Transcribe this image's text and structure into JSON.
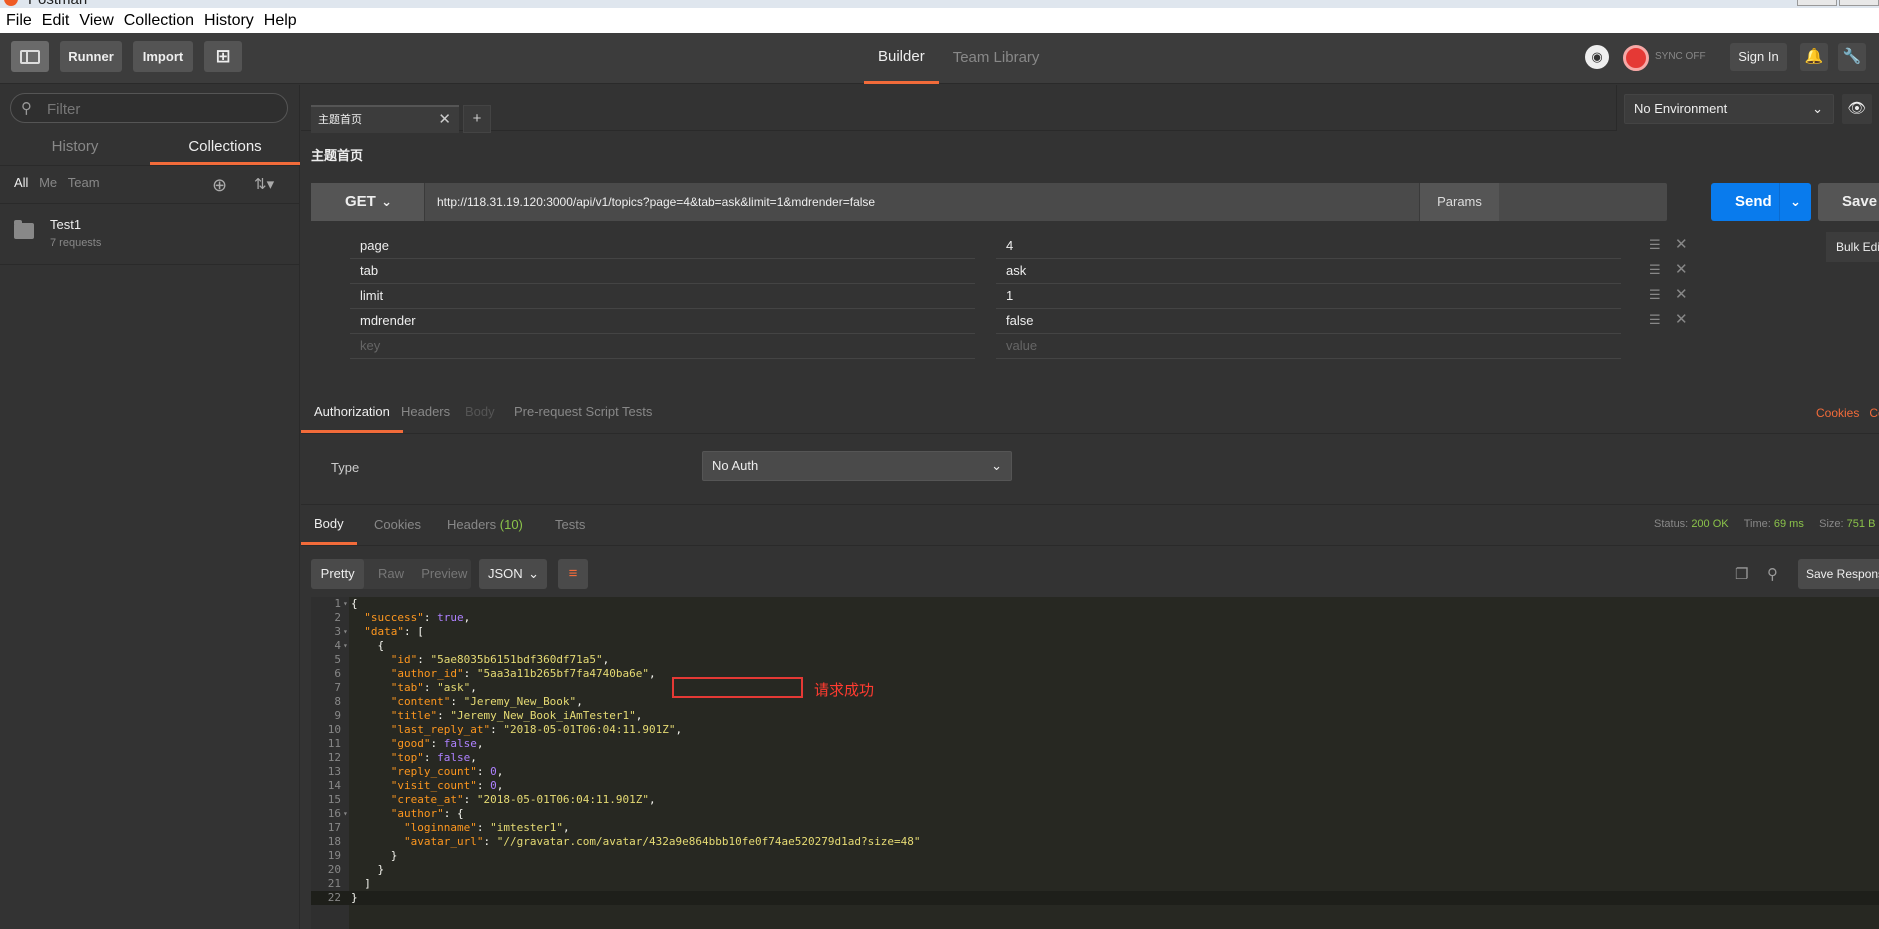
{
  "app": {
    "title": "Postman"
  },
  "menu": [
    "File",
    "Edit",
    "View",
    "Collection",
    "History",
    "Help"
  ],
  "toolbar": {
    "runner": "Runner",
    "import": "Import",
    "tabs": [
      "Builder",
      "Team Library"
    ],
    "sync_status": "SYNC OFF",
    "sign_in": "Sign In"
  },
  "sidebar": {
    "filter_placeholder": "Filter",
    "tabs": [
      "History",
      "Collections"
    ],
    "filters": [
      "All",
      "Me",
      "Team"
    ],
    "collections": [
      {
        "name": "Test1",
        "count": "7 requests"
      }
    ]
  },
  "request": {
    "tab_name": "主题首页",
    "name": "主题首页",
    "method": "GET",
    "url": "http://118.31.19.120:3000/api/v1/topics?page=4&tab=ask&limit=1&mdrender=false",
    "params_label": "Params",
    "send_label": "Send",
    "save_label": "Save",
    "params": [
      {
        "key": "page",
        "value": "4"
      },
      {
        "key": "tab",
        "value": "ask"
      },
      {
        "key": "limit",
        "value": "1"
      },
      {
        "key": "mdrender",
        "value": "false"
      }
    ],
    "key_placeholder": "key",
    "value_placeholder": "value",
    "bulk_edit": "Bulk Edit"
  },
  "environment": {
    "selected": "No Environment"
  },
  "req_tabs": [
    "Authorization",
    "Headers",
    "Body",
    "Pre-request Script",
    "Tests"
  ],
  "req_links": {
    "cookies": "Cookies",
    "code": "Code"
  },
  "auth": {
    "type_label": "Type",
    "selected": "No Auth"
  },
  "response": {
    "tabs": [
      "Body",
      "Cookies",
      "Headers",
      "Tests"
    ],
    "headers_count": "(10)",
    "status_label": "Status:",
    "status": "200 OK",
    "time_label": "Time:",
    "time": "69 ms",
    "size_label": "Size:",
    "size": "751 B",
    "views": [
      "Pretty",
      "Raw",
      "Preview"
    ],
    "format": "JSON",
    "save_label": "Save Response",
    "annotation": "请求成功"
  },
  "code_lines": [
    "{",
    "  \"success\": true,",
    "  \"data\": [",
    "    {",
    "      \"id\": \"5ae8035b6151bdf360df71a5\",",
    "      \"author_id\": \"5aa3a11b265bf7fa4740ba6e\",",
    "      \"tab\": \"ask\",",
    "      \"content\": \"Jeremy_New_Book\",",
    "      \"title\": \"Jeremy_New_Book_iAmTester1\",",
    "      \"last_reply_at\": \"2018-05-01T06:04:11.901Z\",",
    "      \"good\": false,",
    "      \"top\": false,",
    "      \"reply_count\": 0,",
    "      \"visit_count\": 0,",
    "      \"create_at\": \"2018-05-01T06:04:11.901Z\",",
    "      \"author\": {",
    "        \"loginname\": \"imtester1\",",
    "        \"avatar_url\": \"//gravatar.com/avatar/432a9e864bbb10fe0f74ae520279d1ad?size=48\"",
    "      }",
    "    }",
    "  ]",
    "}"
  ]
}
